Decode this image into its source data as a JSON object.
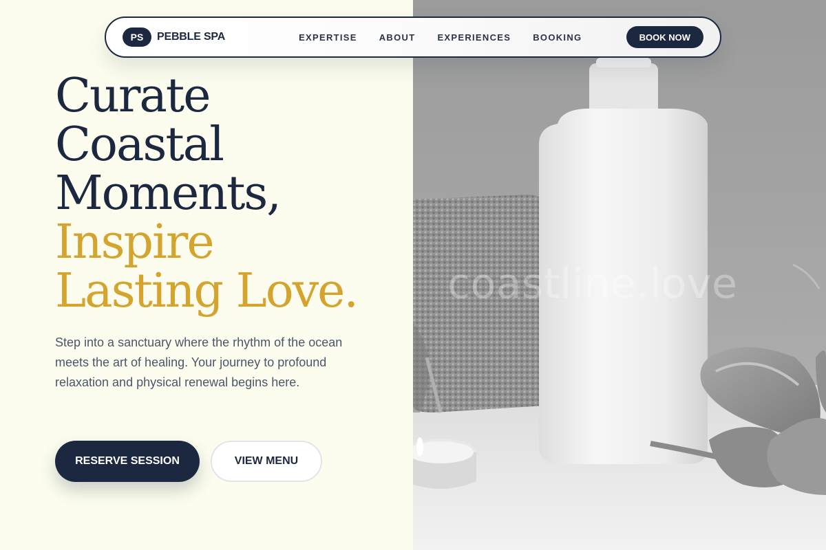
{
  "nav": {
    "logo_text": "PS",
    "brand_name": "PEBBLE SPA",
    "links": [
      "EXPERTISE",
      "ABOUT",
      "EXPERIENCES",
      "BOOKING"
    ],
    "cta_label": "BOOK NOW"
  },
  "hero": {
    "headline_lines": [
      "Curate",
      "Coastal",
      "Moments,"
    ],
    "headline_accent_lines": [
      "Inspire",
      "Lasting Love."
    ],
    "subtext": "Step into a sanctuary where the rhythm of the ocean meets the art of healing. Your journey to profound relaxation and physical renewal begins here.",
    "primary_cta": "RESERVE SESSION",
    "secondary_cta": "VIEW MENU"
  },
  "photo": {
    "watermark": "coastline.love",
    "subject": "spa-bottle-towel-tulips-candle"
  },
  "colors": {
    "background": "#fcfdee",
    "navy": "#1c2740",
    "gold_accent": "#d4a42e",
    "body_text": "#4c566a"
  }
}
